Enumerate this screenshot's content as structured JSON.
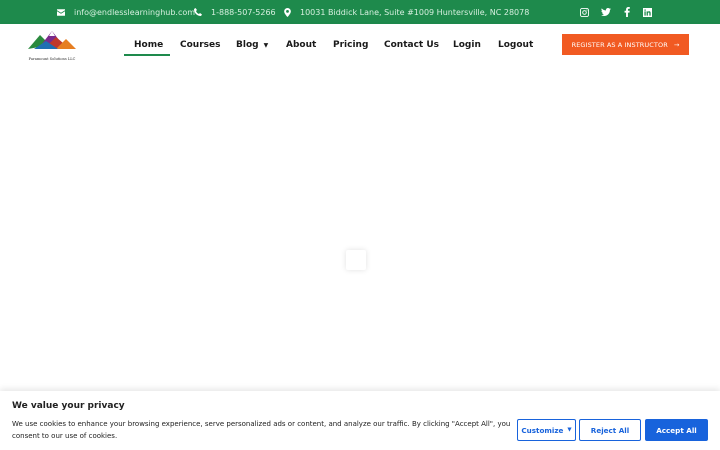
{
  "topbar": {
    "email": "info@endlesslearninghub.com",
    "phone": "1-888-507-5266",
    "address": "10031 Biddick Lane, Suite #1009 Huntersville, NC 28078",
    "social_icons": [
      "instagram-icon",
      "twitter-icon",
      "facebook-icon",
      "linkedin-icon"
    ]
  },
  "brand": {
    "logo_text": "Paramount Solutions LLC"
  },
  "nav": {
    "items": [
      {
        "label": "Home",
        "active": true
      },
      {
        "label": "Courses"
      },
      {
        "label": "Blog",
        "has_dropdown": true
      },
      {
        "label": "About"
      },
      {
        "label": "Pricing"
      },
      {
        "label": "Contact Us"
      },
      {
        "label": "Login"
      },
      {
        "label": "Logout"
      }
    ],
    "cta_label": "REGISTER AS A INSTRUCTOR",
    "cta_arrow": "→"
  },
  "cookie": {
    "title": "We value your privacy",
    "text": "We use cookies to enhance your browsing experience, serve personalized ads or content, and analyze our traffic. By clicking \"Accept All\", you consent to our use of cookies.",
    "customize_label": "Customize",
    "reject_label": "Reject All",
    "accept_label": "Accept All"
  },
  "colors": {
    "topbar_green": "#1e8a4c",
    "cta_orange": "#f15a22",
    "cookie_blue": "#1863dc"
  }
}
